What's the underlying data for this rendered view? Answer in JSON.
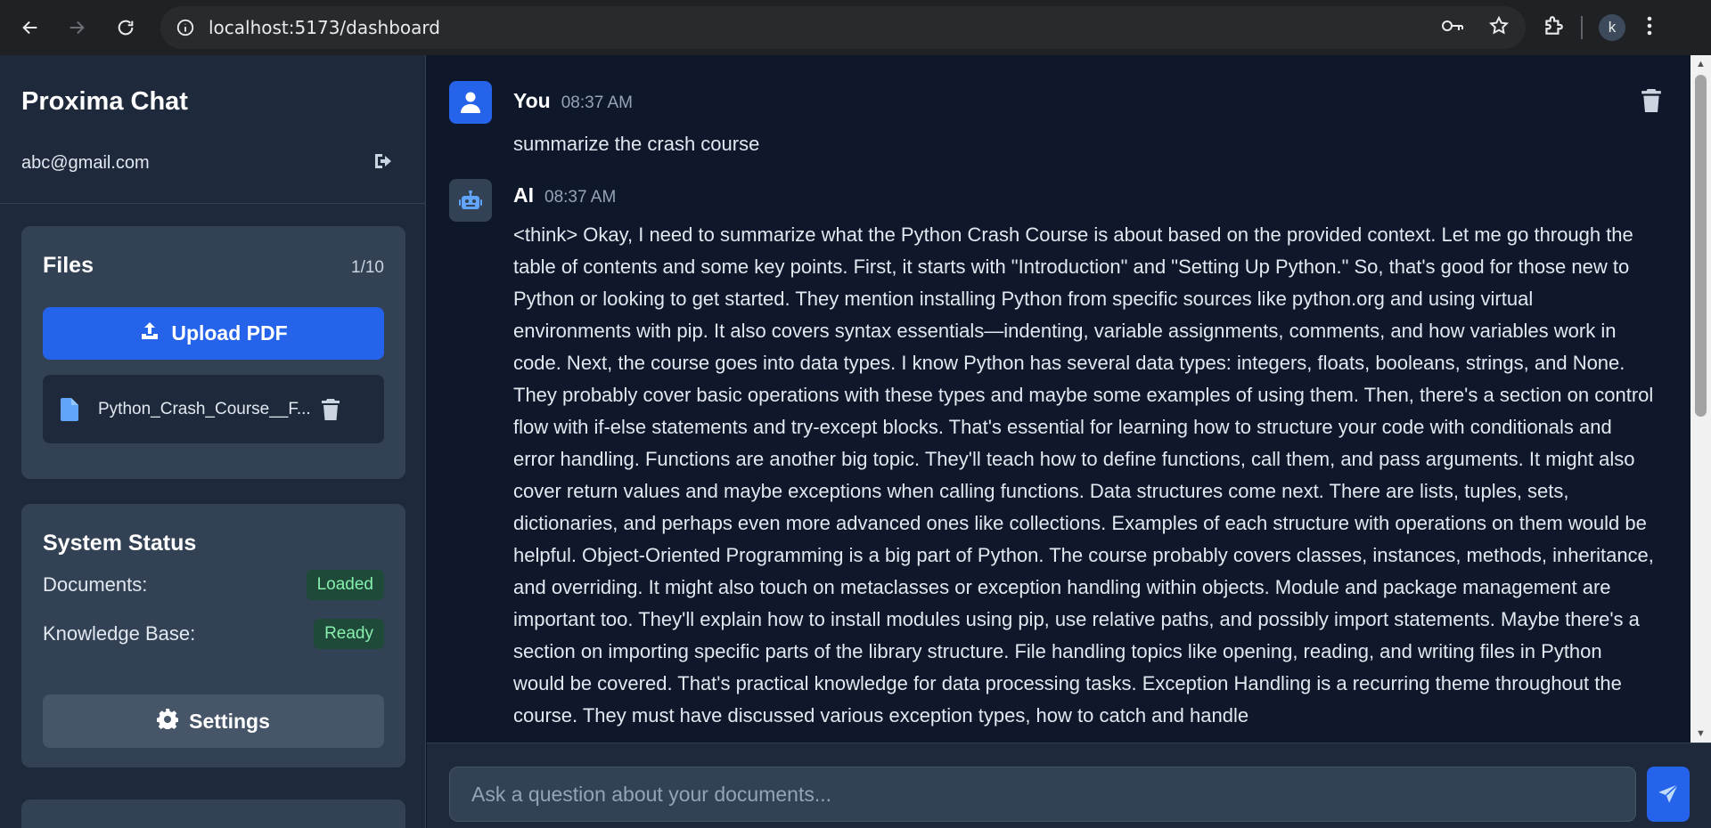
{
  "browser": {
    "url": "localhost:5173/dashboard",
    "profile_initial": "k"
  },
  "sidebar": {
    "app_title": "Proxima Chat",
    "user_email": "abc@gmail.com",
    "files": {
      "title": "Files",
      "count": "1/10",
      "upload_label": "Upload PDF",
      "items": [
        {
          "name": "Python_Crash_Course__F..."
        }
      ]
    },
    "status": {
      "title": "System Status",
      "rows": [
        {
          "label": "Documents:",
          "value": "Loaded"
        },
        {
          "label": "Knowledge Base:",
          "value": "Ready"
        }
      ],
      "settings_label": "Settings"
    }
  },
  "chat": {
    "messages": [
      {
        "sender": "You",
        "time": "08:37 AM",
        "text": "summarize the crash course"
      },
      {
        "sender": "AI",
        "time": "08:37 AM",
        "text": "<think> Okay, I need to summarize what the Python Crash Course is about based on the provided context. Let me go through the table of contents and some key points. First, it starts with \"Introduction\" and \"Setting Up Python.\" So, that's good for those new to Python or looking to get started. They mention installing Python from specific sources like python.org and using virtual environments with pip. It also covers syntax essentials—indenting, variable assignments, comments, and how variables work in code. Next, the course goes into data types. I know Python has several data types: integers, floats, booleans, strings, and None. They probably cover basic operations with these types and maybe some examples of using them. Then, there's a section on control flow with if-else statements and try-except blocks. That's essential for learning how to structure your code with conditionals and error handling. Functions are another big topic. They'll teach how to define functions, call them, and pass arguments. It might also cover return values and maybe exceptions when calling functions. Data structures come next. There are lists, tuples, sets, dictionaries, and perhaps even more advanced ones like collections. Examples of each structure with operations on them would be helpful. Object-Oriented Programming is a big part of Python. The course probably covers classes, instances, methods, inheritance, and overriding. It might also touch on metaclasses or exception handling within objects. Module and package management are important too. They'll explain how to install modules using pip, use relative paths, and possibly import statements. Maybe there's a section on importing specific parts of the library structure. File handling topics like opening, reading, and writing files in Python would be covered. That's practical knowledge for data processing tasks. Exception Handling is a recurring theme throughout the course. They must have discussed various exception types, how to catch and handle"
      }
    ],
    "input_placeholder": "Ask a question about your documents..."
  }
}
